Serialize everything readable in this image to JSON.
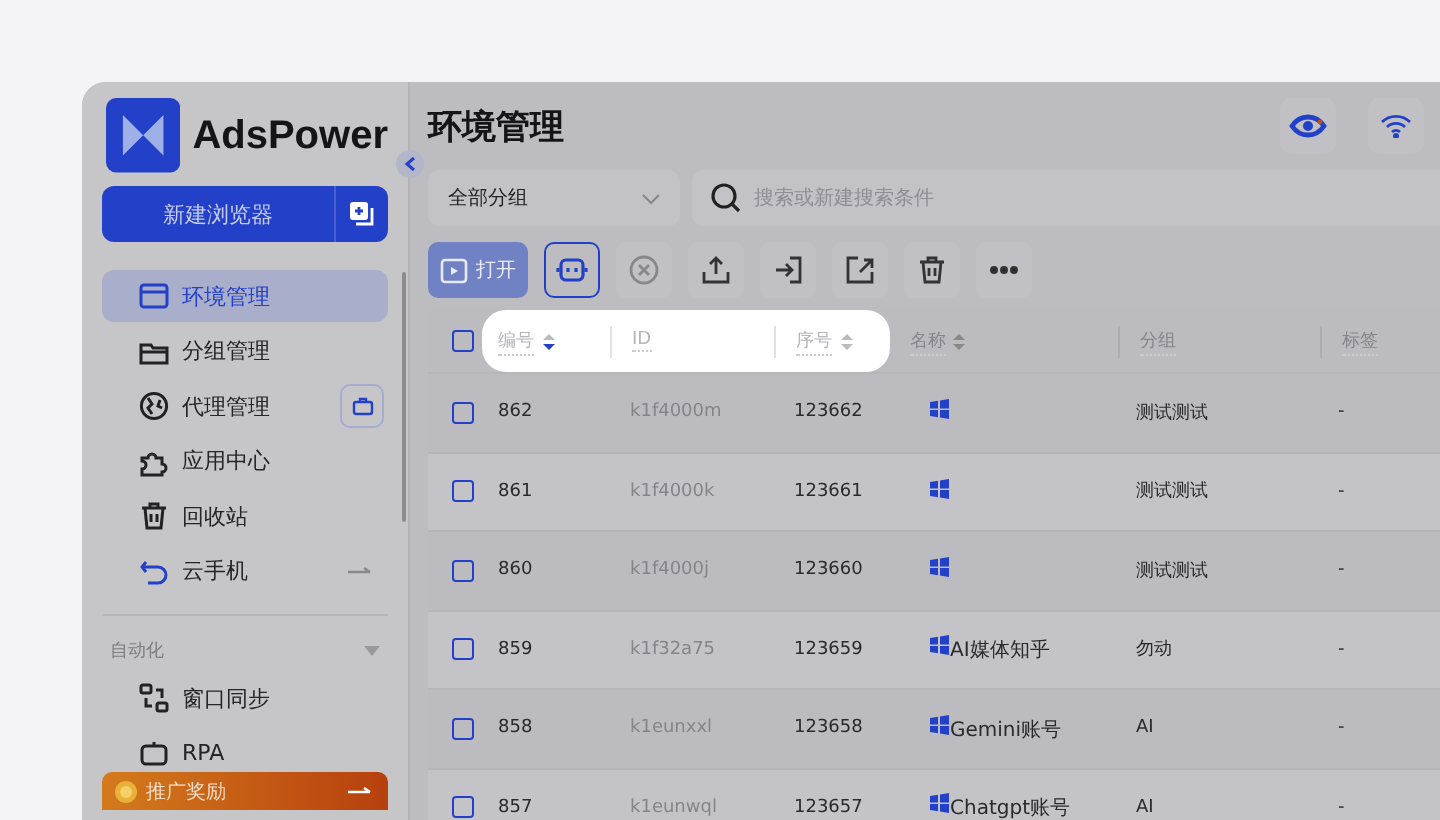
{
  "sidebar": {
    "logo": "AdsPower",
    "new_button": "新建浏览器",
    "items": [
      {
        "label": "环境管理",
        "selected": true
      },
      {
        "label": "分组管理",
        "selected": false
      },
      {
        "label": "代理管理",
        "selected": false,
        "kind": "button"
      },
      {
        "label": "应用中心",
        "selected": false
      },
      {
        "label": "回收站",
        "selected": false
      },
      {
        "label": "云手机",
        "selected": false,
        "kind": "arrow"
      }
    ],
    "section": {
      "label": "自动化",
      "expanded": true,
      "items": [
        {
          "label": "窗口同步",
          "selected": false
        },
        {
          "label": "RPA",
          "selected": false
        }
      ]
    },
    "promo": "推广奖励"
  },
  "main": {
    "title": "环境管理",
    "group_select": "全部分组",
    "search": {
      "placeholder": "搜索或新建搜索条件"
    },
    "open_button": "打开",
    "table": {
      "select_all_checked": false,
      "columns": [
        {
          "label": "编号",
          "kind": "sortable",
          "sorted_desc": true,
          "spotlight": true
        },
        {
          "label": "ID",
          "spotlight": true
        },
        {
          "label": "序号",
          "kind": "sortable",
          "sorted_desc": false,
          "spotlight": true
        },
        {
          "label": "名称",
          "kind": "sortable",
          "sorted_desc": false,
          "spotlight": false
        },
        {
          "label": "分组",
          "spotlight": false
        },
        {
          "label": "标签",
          "spotlight": false
        }
      ],
      "rows": [
        {
          "checked": false,
          "no": "862",
          "id": "k1f4000m",
          "seq": "123662",
          "group": "测试测试",
          "tag": "-"
        },
        {
          "checked": false,
          "no": "861",
          "id": "k1f4000k",
          "seq": "123661",
          "group": "测试测试",
          "tag": "-"
        },
        {
          "checked": false,
          "no": "860",
          "id": "k1f4000j",
          "seq": "123660",
          "group": "测试测试",
          "tag": "-"
        },
        {
          "checked": false,
          "no": "859",
          "id": "k1f32a75",
          "seq": "123659",
          "name": "AI媒体知乎",
          "group": "勿动",
          "tag": "-"
        },
        {
          "checked": false,
          "no": "858",
          "id": "k1eunxxl",
          "seq": "123658",
          "name": "Gemini账号",
          "group": "AI",
          "tag": "-"
        },
        {
          "checked": false,
          "no": "857",
          "id": "k1eunwql",
          "seq": "123657",
          "name": "Chatgpt账号",
          "group": "AI",
          "tag": "-"
        }
      ]
    }
  }
}
